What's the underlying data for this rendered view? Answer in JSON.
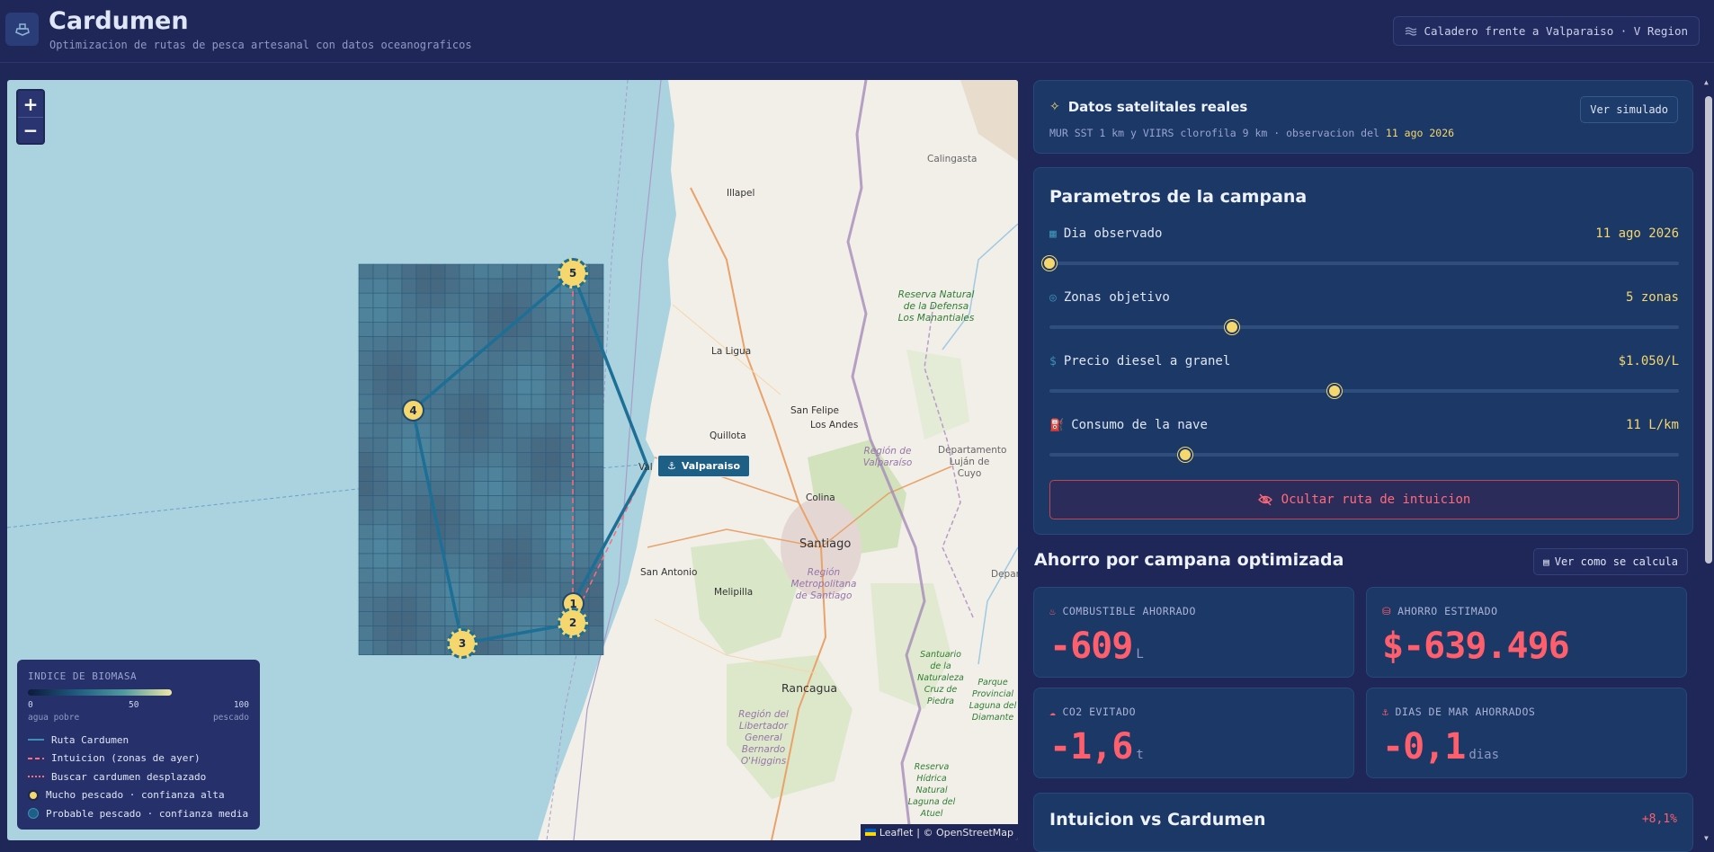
{
  "header": {
    "title": "Cardumen",
    "subtitle": "Optimizacion de rutas de pesca artesanal con datos oceanograficos",
    "region": "Caladero frente a Valparaiso · V Region"
  },
  "map": {
    "zoom_in": "+",
    "zoom_out": "−",
    "port_label": "Valparaiso",
    "attribution_leaflet": "Leaflet",
    "attribution_osm": "| © OpenStreetMap",
    "places": {
      "calingasta": "Calingasta",
      "illapel": "Illapel",
      "la_ligua": "La Ligua",
      "san_felipe": "San Felipe",
      "los_andes": "Los Andes",
      "quillota": "Quillota",
      "val_partial": "Val",
      "colina": "Colina",
      "santiago": "Santiago",
      "san_antonio": "San Antonio",
      "melipilla": "Melipilla",
      "region_metropolitana": "Región Metropolitana de Santiago",
      "rancagua": "Rancagua",
      "region_valparaiso": "Región de Valparaíso",
      "reserva_manantiales": "Reserva Natural de la Defensa Los Manantiales",
      "departamento_lujan": "Departamento Luján de Cuyo",
      "departamento_partial": "Depar",
      "region_ohiggins": "Región del Libertador General Bernardo O'Higgins",
      "santuario_cruz": "Santuario de la Naturaleza Cruz de Piedra",
      "parque_provincial": "Parque Provincial Laguna del Diamante",
      "reserva_atuel": "Reserva Hídrica Natural Laguna del Atuel"
    },
    "route_points": [
      "1",
      "2",
      "3",
      "4",
      "5"
    ],
    "legend": {
      "title": "INDICE DE BIOMASA",
      "tick_min": "0",
      "tick_mid": "50",
      "tick_max": "100",
      "low_label": "agua pobre",
      "high_label": "pescado",
      "items": [
        {
          "label": "Ruta Cardumen",
          "color": "#3d8fb5"
        },
        {
          "label": "Intuicion (zonas de ayer)",
          "color": "#ff6b7a"
        },
        {
          "label": "Buscar cardumen desplazado",
          "color": "#ff6b7a"
        },
        {
          "label": "Mucho pescado · confianza alta",
          "color": "#f5d76e"
        },
        {
          "label": "Probable pescado · confianza media",
          "color": "#1e5f86"
        }
      ]
    }
  },
  "satellite": {
    "title": "Datos satelitales reales",
    "description": "MUR SST 1 km y VIIRS clorofila 9 km · observacion del",
    "date": "11 ago 2026",
    "button": "Ver simulado"
  },
  "params": {
    "title": "Parametros de la campana",
    "items": [
      {
        "label": "Dia observado",
        "value": "11 ago 2026",
        "level": 0.0
      },
      {
        "label": "Zonas objetivo",
        "value": "5 zonas",
        "level": 0.29
      },
      {
        "label": "Precio diesel a granel",
        "value": "$1.050/L",
        "level": 0.453
      },
      {
        "label": "Consumo de la nave",
        "value": "11 L/km",
        "level": 0.216
      }
    ],
    "toggle_button": "Ocultar ruta de intuicion"
  },
  "savings": {
    "title": "Ahorro por campana optimizada",
    "how_button": "Ver como se calcula",
    "metrics": [
      {
        "label": "COMBUSTIBLE AHORRADO",
        "value": "-609",
        "unit": "L"
      },
      {
        "label": "AHORRO ESTIMADO",
        "value": "$-639.496",
        "unit": ""
      },
      {
        "label": "CO2 EVITADO",
        "value": "-1,6",
        "unit": "t"
      },
      {
        "label": "DIAS DE MAR AHORRADOS",
        "value": "-0,1",
        "unit": "dias"
      }
    ]
  },
  "comparison": {
    "title": "Intuicion vs Cardumen",
    "delta": "+8,1%"
  },
  "colors": {
    "background": "#1f2658",
    "accent": "#f5d76e",
    "negative": "#ff5f6d",
    "ocean": "#aad3df",
    "card": "#1b3866"
  }
}
